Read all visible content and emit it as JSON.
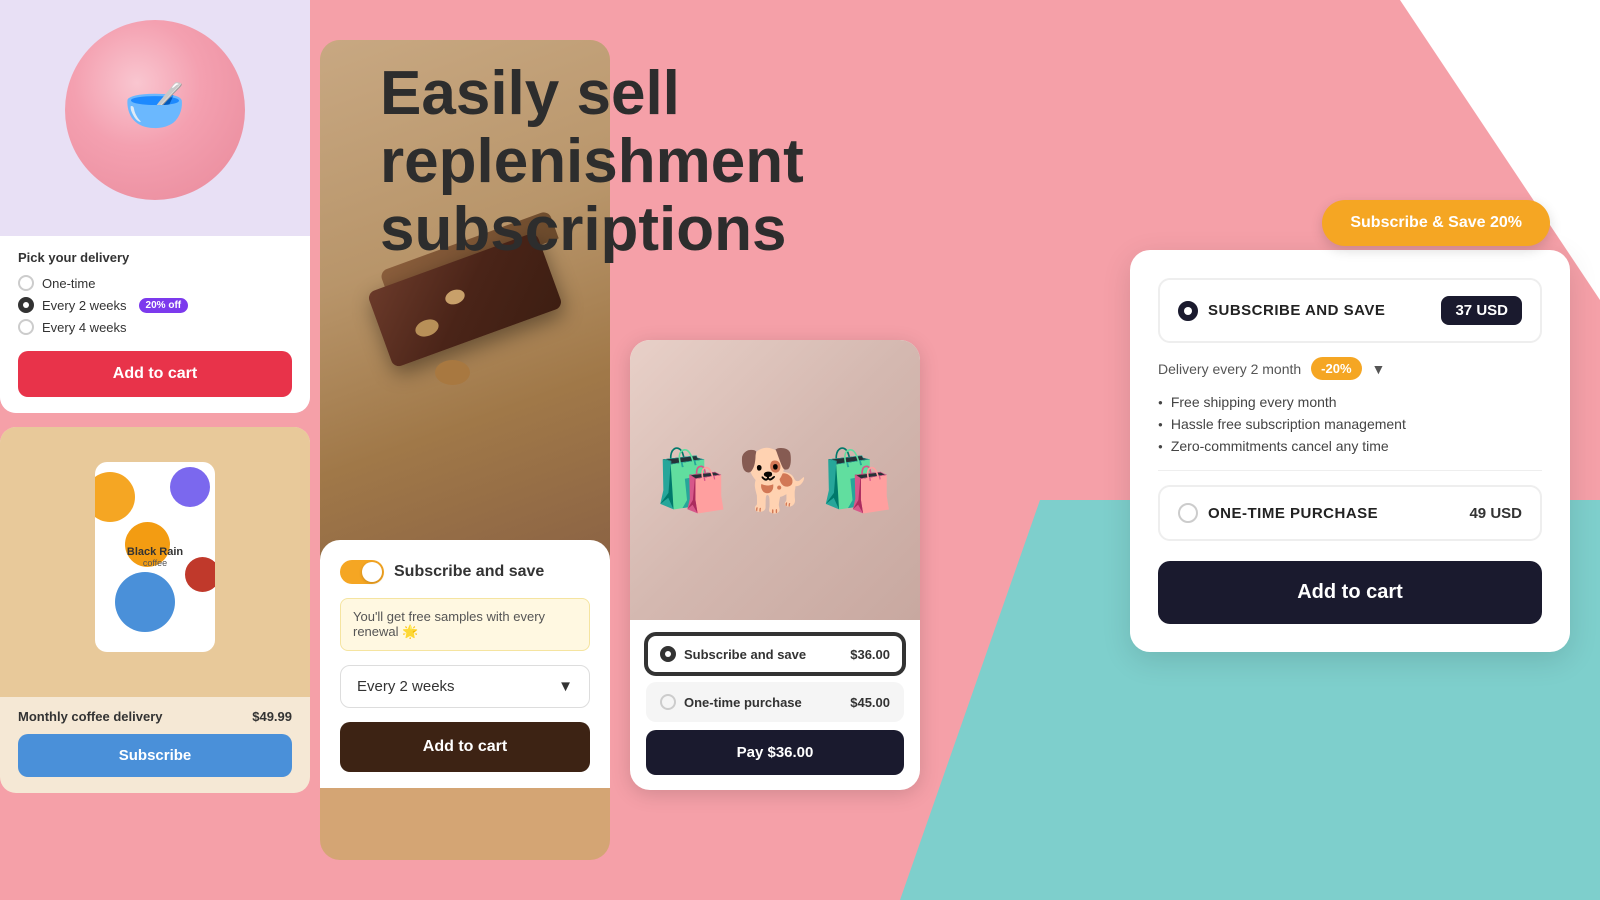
{
  "background": {
    "pink": "#f5a0a8",
    "teal": "#7ecfcc",
    "white": "#ffffff"
  },
  "hero": {
    "title": "Easily sell replenishment subscriptions"
  },
  "subscribe_save_btn": "Subscribe & Save 20%",
  "card1": {
    "image_emoji": "🥣",
    "delivery_label": "Pick your delivery",
    "options": [
      {
        "label": "One-time",
        "selected": false
      },
      {
        "label": "Every 2 weeks",
        "selected": true,
        "badge": "20% off"
      },
      {
        "label": "Every 4 weeks",
        "selected": false
      }
    ],
    "add_to_cart": "Add to cart"
  },
  "card2": {
    "brand": "Black Rain",
    "product": "coffee",
    "title": "Monthly coffee delivery",
    "price": "$49.99",
    "subscribe_btn": "Subscribe"
  },
  "choc_card": {
    "toggle_label": "Subscribe and save",
    "renewal_text": "You'll get free samples with every renewal 🌟",
    "dropdown_label": "Every 2 weeks",
    "add_to_cart": "Add to cart"
  },
  "dog_card": {
    "options": [
      {
        "label": "Subscribe and save",
        "price": "$36.00",
        "selected": true
      },
      {
        "label": "One-time purchase",
        "price": "$45.00",
        "selected": false
      }
    ],
    "pay_btn": "Pay  $36.00"
  },
  "widget": {
    "subscribe_option": {
      "title": "SUBSCRIBE AND SAVE",
      "price": "37 USD",
      "delivery": "Delivery every 2 month",
      "discount": "-20%",
      "benefits": [
        "Free shipping every month",
        "Hassle free subscription management",
        "Zero-commitments cancel any time"
      ]
    },
    "otp_option": {
      "title": "ONE-TIME PURCHASE",
      "price": "49 USD"
    },
    "add_to_cart": "Add to cart"
  }
}
